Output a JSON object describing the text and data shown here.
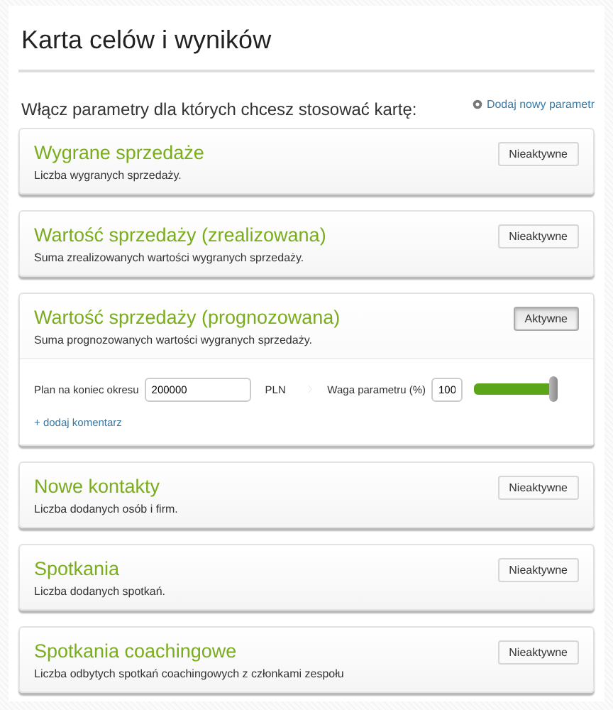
{
  "page": {
    "title": "Karta celów i wyników"
  },
  "intro": {
    "text": "Włącz parametry dla których chcesz stosować kartę:",
    "add_link": "Dodaj nowy parametr"
  },
  "parameters": [
    {
      "name": "Wygrane sprzedaże",
      "description": "Liczba wygranych sprzedaży.",
      "status": "Nieaktywne",
      "active": false
    },
    {
      "name": "Wartość sprzedaży (zrealizowana)",
      "description": "Suma zrealizowanych wartości wygranych sprzedaży.",
      "status": "Nieaktywne",
      "active": false
    },
    {
      "name": "Wartość sprzedaży (prognozowana)",
      "description": "Suma prognozowanych wartości wygranych sprzedaży.",
      "status": "Aktywne",
      "active": true,
      "plan_label": "Plan na koniec okresu",
      "plan_value": "200000",
      "currency": "PLN",
      "weight_label": "Waga parametru (%)",
      "weight_value": "100",
      "level": 1,
      "comment_link": "+ dodaj komentarz"
    },
    {
      "name": "Nowe kontakty",
      "description": "Liczba dodanych osób i firm.",
      "status": "Nieaktywne",
      "active": false
    },
    {
      "name": "Spotkania",
      "description": "Liczba dodanych spotkań.",
      "status": "Nieaktywne",
      "active": false
    },
    {
      "name": "Spotkania coachingowe",
      "description": "Liczba odbytych spotkań coachingowych z członkami zespołu",
      "status": "Nieaktywne",
      "active": false
    }
  ]
}
